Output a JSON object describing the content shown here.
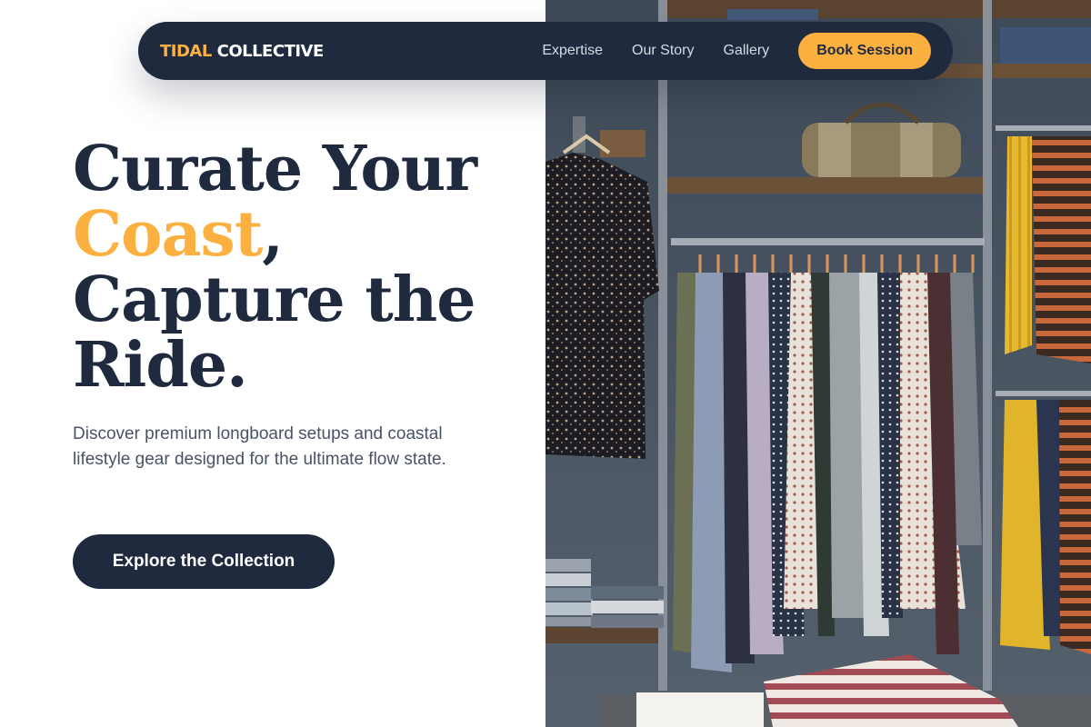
{
  "nav": {
    "brand_part1": "TIDAL",
    "brand_part2": "COLLECTIVE",
    "links": [
      "Expertise",
      "Our Story",
      "Gallery"
    ],
    "cta_label": "Book Session"
  },
  "hero": {
    "title_line1": "Curate Your",
    "title_accent": "Coast",
    "title_comma": ",",
    "title_line3": "Capture the",
    "title_line4": "Ride.",
    "subtitle": "Discover premium longboard setups and coastal lifestyle gear designed for the ultimate flow state.",
    "button_label": "Explore the Collection"
  },
  "colors": {
    "navy": "#1f2a3f",
    "accent": "#fbb040",
    "text_muted": "#4a5363"
  }
}
